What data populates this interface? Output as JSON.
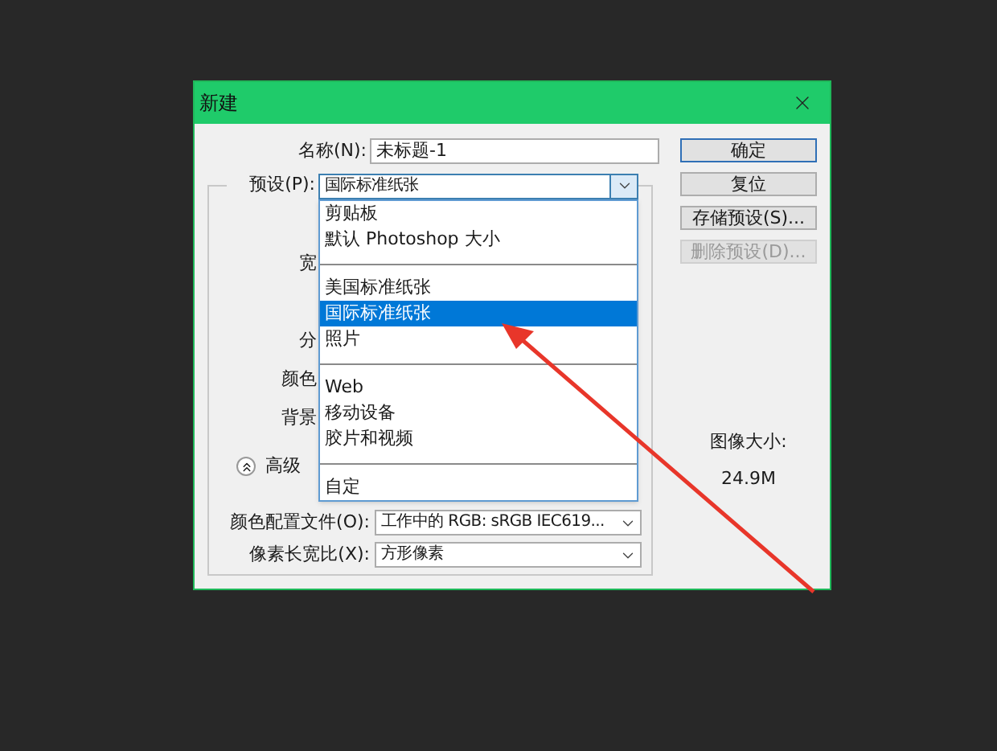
{
  "window": {
    "title": "新建"
  },
  "name_field": {
    "label": "名称(N):",
    "value": "未标题-1"
  },
  "preset": {
    "label": "预设(P):",
    "value": "国际标准纸张",
    "open": true
  },
  "covered_labels": [
    "宽",
    "分",
    "颜色",
    "背景"
  ],
  "advanced": {
    "label": "高级",
    "expanded": true
  },
  "color_profile": {
    "label": "颜色配置文件(O):",
    "value": "工作中的 RGB: sRGB IEC619..."
  },
  "pixel_aspect": {
    "label": "像素长宽比(X):",
    "value": "方形像素"
  },
  "buttons": [
    {
      "label": "确定",
      "default": true,
      "disabled": false
    },
    {
      "label": "复位",
      "default": false,
      "disabled": false
    },
    {
      "label": "存储预设(S)...",
      "default": false,
      "disabled": false
    },
    {
      "label": "删除预设(D)...",
      "default": false,
      "disabled": true
    }
  ],
  "image_size": {
    "label": "图像大小:",
    "value": "24.9M"
  },
  "dropdown": [
    {
      "kind": "item",
      "label": "剪贴板",
      "selected": false
    },
    {
      "kind": "item",
      "label": "默认 Photoshop 大小",
      "selected": false
    },
    {
      "kind": "separator"
    },
    {
      "kind": "item",
      "label": "美国标准纸张",
      "selected": false
    },
    {
      "kind": "item",
      "label": "国际标准纸张",
      "selected": true
    },
    {
      "kind": "item",
      "label": "照片",
      "selected": false
    },
    {
      "kind": "separator"
    },
    {
      "kind": "item",
      "label": "Web",
      "selected": false
    },
    {
      "kind": "item",
      "label": "移动设备",
      "selected": false
    },
    {
      "kind": "item",
      "label": "胶片和视频",
      "selected": false
    },
    {
      "kind": "separator"
    },
    {
      "kind": "item",
      "label": "自定",
      "selected": false
    }
  ]
}
